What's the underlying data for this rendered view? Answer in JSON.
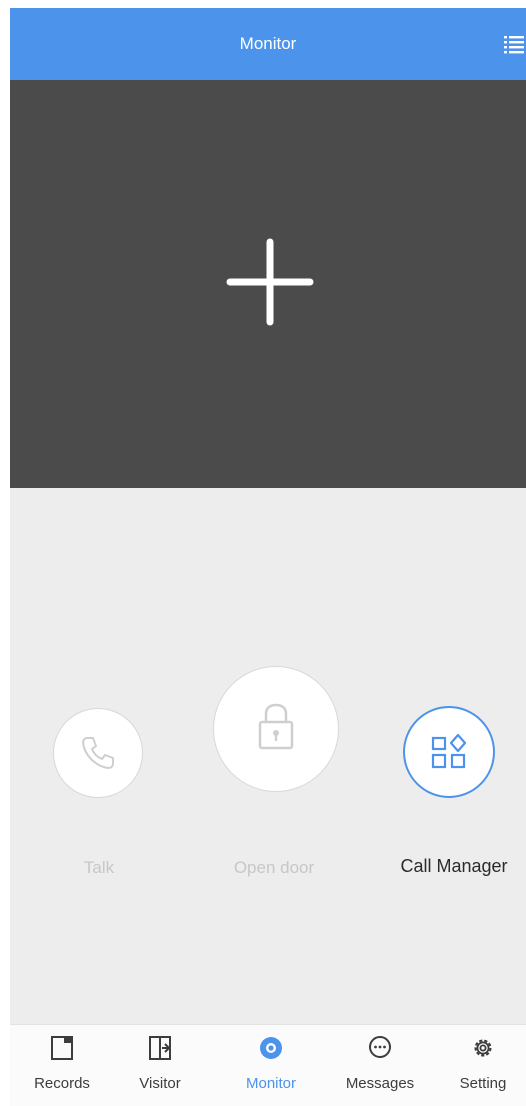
{
  "header": {
    "title": "Monitor",
    "menu_icon": "list-icon"
  },
  "video": {
    "add_icon": "plus-icon"
  },
  "controls": [
    {
      "label": "Talk",
      "icon": "phone-icon",
      "enabled": false
    },
    {
      "label": "Open door",
      "icon": "lock-icon",
      "enabled": false
    },
    {
      "label": "Call Manager",
      "icon": "apps-icon",
      "enabled": true
    }
  ],
  "tabs": [
    {
      "label": "Records",
      "icon": "record-icon",
      "active": false
    },
    {
      "label": "Visitor",
      "icon": "visitor-icon",
      "active": false
    },
    {
      "label": "Monitor",
      "icon": "monitor-icon",
      "active": true
    },
    {
      "label": "Messages",
      "icon": "chat-icon",
      "active": false
    },
    {
      "label": "Setting",
      "icon": "gear-icon",
      "active": false
    }
  ],
  "colors": {
    "accent": "#4c93ec",
    "video_bg": "#4b4b4b",
    "panel_bg": "#ededed",
    "disabled_text": "#c7c7c7"
  }
}
